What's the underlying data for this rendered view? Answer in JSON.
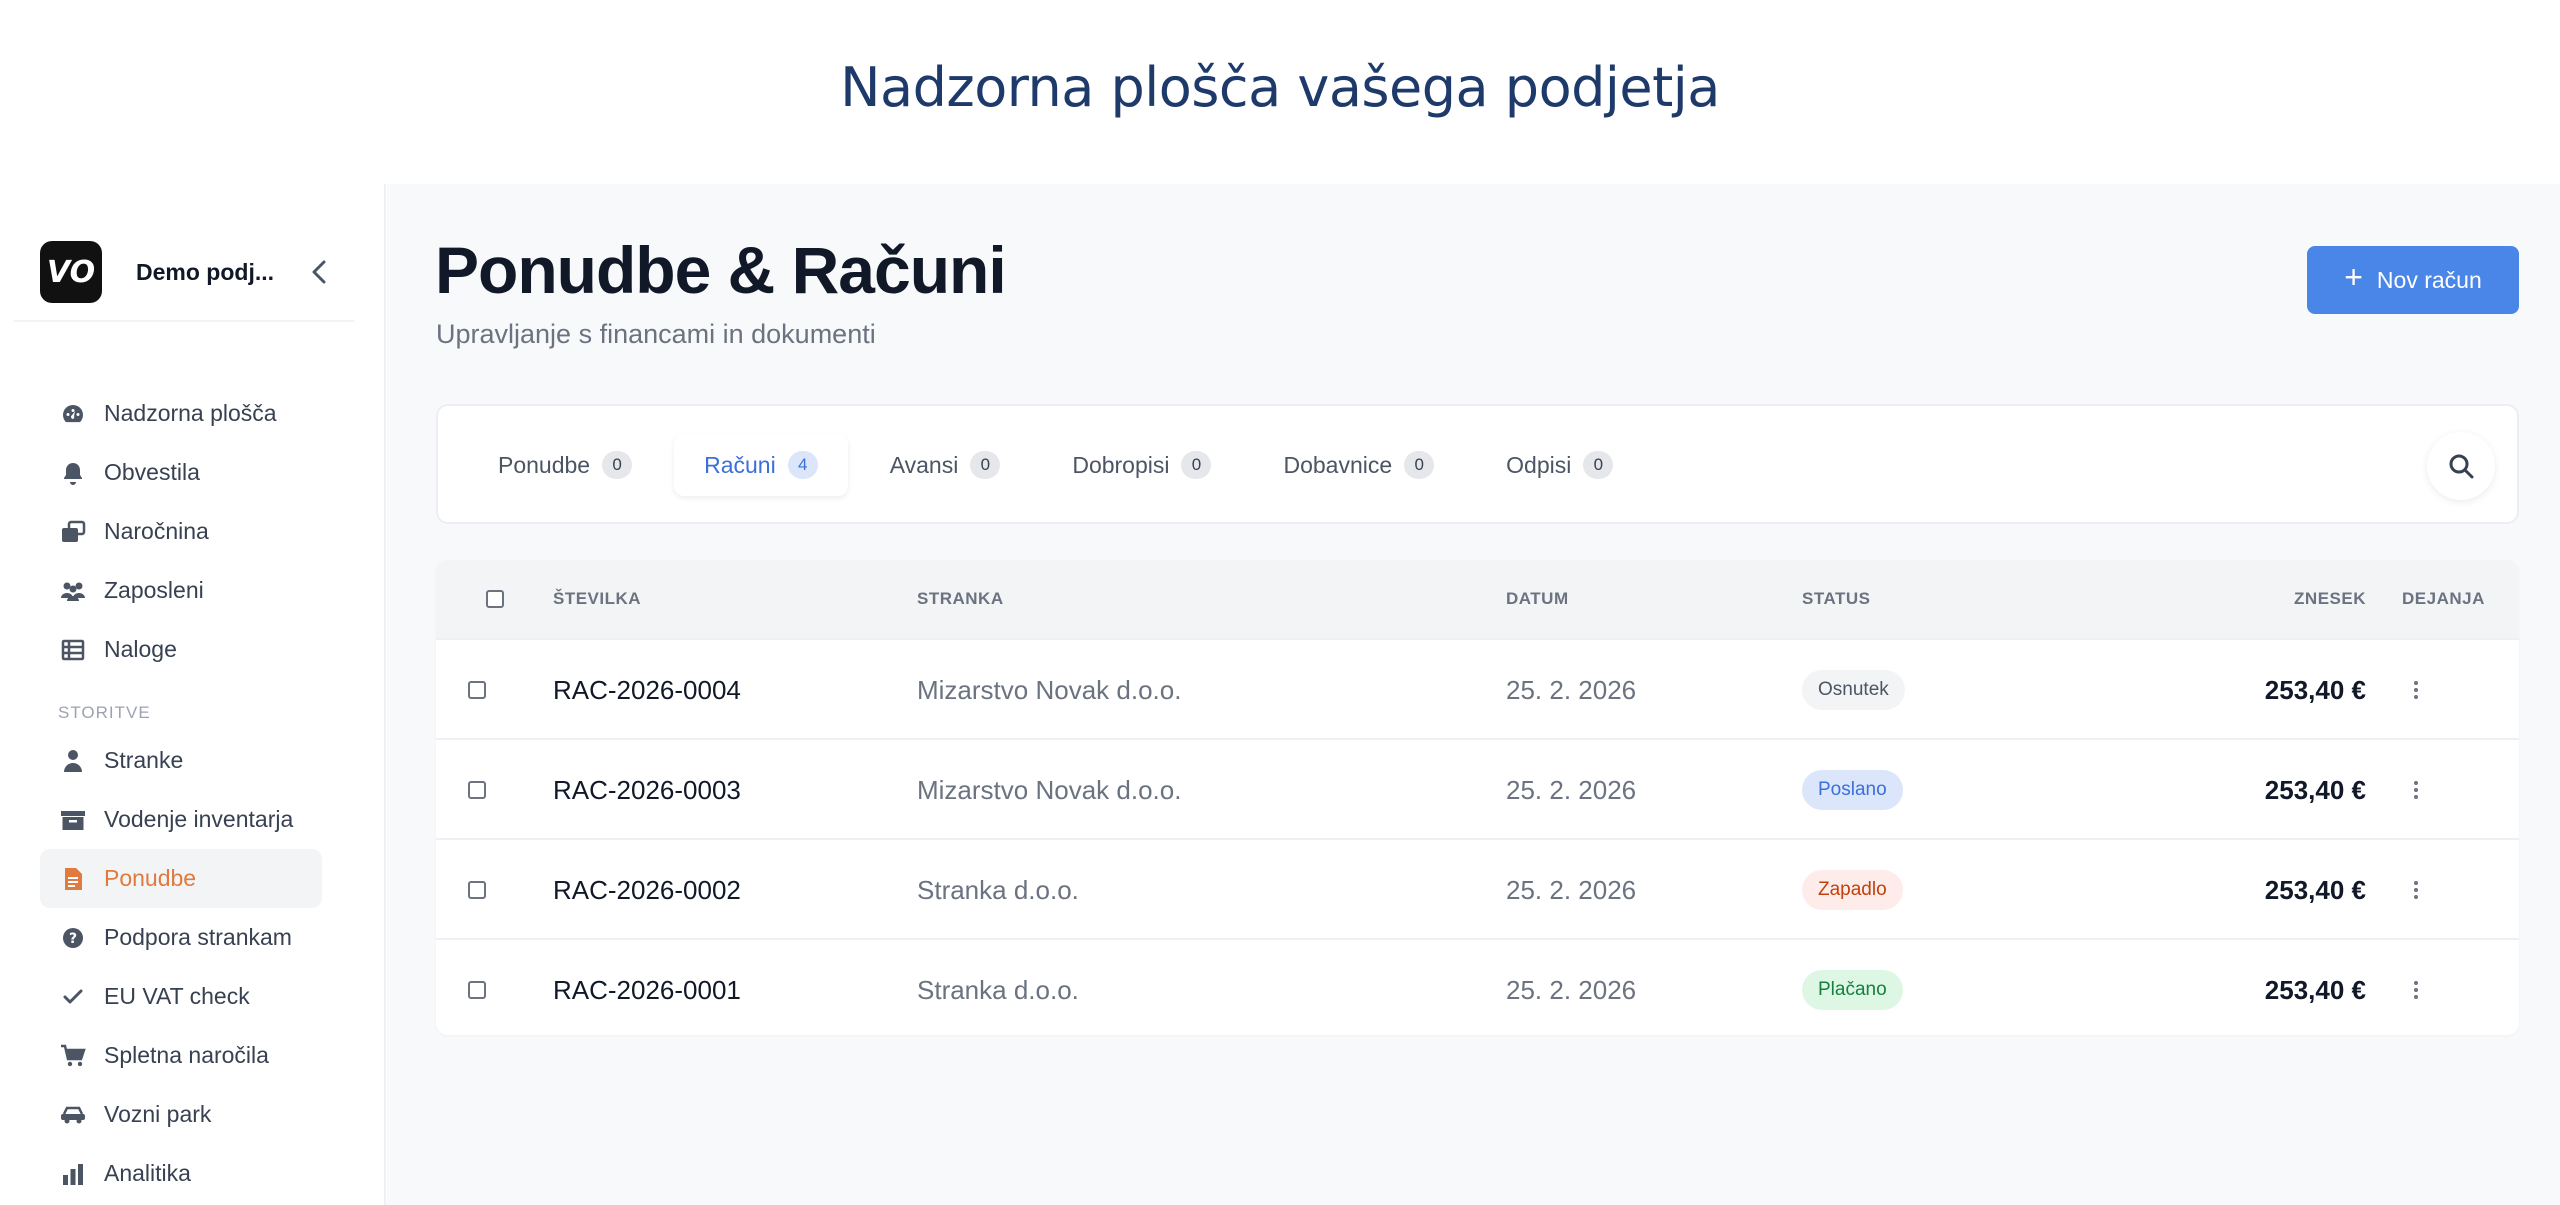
{
  "app": {
    "header_title": "Nadzorna plošča vašega podjetja"
  },
  "sidebar": {
    "brand_logo_text": "VO",
    "company_name": "Demo podj...",
    "items": [
      {
        "label": "Nadzorna plošča",
        "icon": "dashboard-icon"
      },
      {
        "label": "Obvestila",
        "icon": "bell-icon"
      },
      {
        "label": "Naročnina",
        "icon": "subscription-icon"
      },
      {
        "label": "Zaposleni",
        "icon": "users-icon"
      },
      {
        "label": "Naloge",
        "icon": "tasks-icon"
      }
    ],
    "section_label": "STORITVE",
    "service_items": [
      {
        "label": "Stranke",
        "icon": "user-icon"
      },
      {
        "label": "Vodenje inventarja",
        "icon": "inventory-icon"
      },
      {
        "label": "Ponudbe",
        "icon": "document-icon",
        "active": true
      },
      {
        "label": "Podpora strankam",
        "icon": "help-icon"
      },
      {
        "label": "EU VAT check",
        "icon": "check-icon"
      },
      {
        "label": "Spletna naročila",
        "icon": "cart-icon"
      },
      {
        "label": "Vozni park",
        "icon": "car-icon"
      },
      {
        "label": "Analitika",
        "icon": "chart-icon"
      }
    ]
  },
  "main": {
    "title": "Ponudbe & Računi",
    "subtitle": "Upravljanje s financami in dokumenti",
    "new_button_icon": "+",
    "new_button_label": "Nov račun",
    "tabs": [
      {
        "label": "Ponudbe",
        "count": "0"
      },
      {
        "label": "Računi",
        "count": "4",
        "active": true
      },
      {
        "label": "Avansi",
        "count": "0"
      },
      {
        "label": "Dobropisi",
        "count": "0"
      },
      {
        "label": "Dobavnice",
        "count": "0"
      },
      {
        "label": "Odpisi",
        "count": "0"
      }
    ],
    "table": {
      "headers": {
        "number": "ŠTEVILKA",
        "client": "STRANKA",
        "date": "DATUM",
        "status": "STATUS",
        "amount": "ZNESEK",
        "actions": "DEJANJA"
      },
      "rows": [
        {
          "number": "RAC-2026-0004",
          "client": "Mizarstvo Novak d.o.o.",
          "date": "25. 2. 2026",
          "status": "Osnutek",
          "amount": "253,40 €"
        },
        {
          "number": "RAC-2026-0003",
          "client": "Mizarstvo Novak d.o.o.",
          "date": "25. 2. 2026",
          "status": "Poslano",
          "amount": "253,40 €"
        },
        {
          "number": "RAC-2026-0002",
          "client": "Stranka d.o.o.",
          "date": "25. 2. 2026",
          "status": "Zapadlo",
          "amount": "253,40 €"
        },
        {
          "number": "RAC-2026-0001",
          "client": "Stranka d.o.o.",
          "date": "25. 2. 2026",
          "status": "Plačano",
          "amount": "253,40 €"
        }
      ]
    }
  },
  "colors": {
    "accent": "#4a86e8",
    "active_nav": "#e07a3f",
    "status_draft": "#f3f4f6",
    "status_sent": "#dbe6fb",
    "status_overdue": "#fdecea",
    "status_paid": "#def7e5"
  }
}
